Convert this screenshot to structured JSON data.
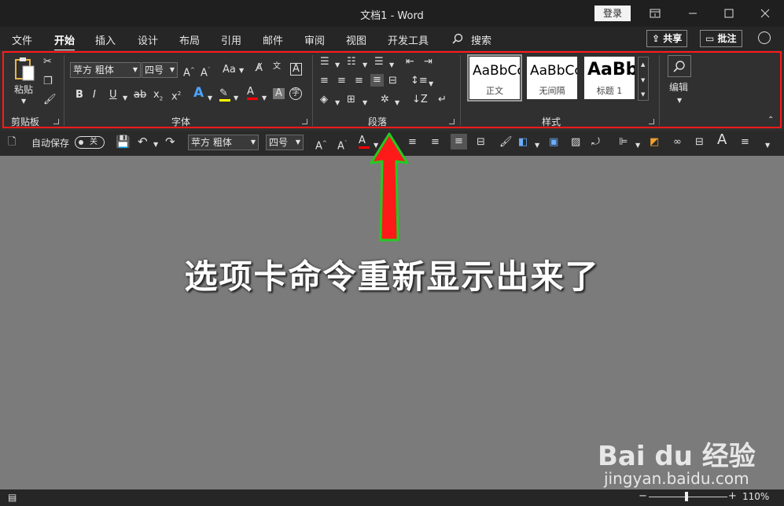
{
  "window": {
    "title": "文档1 - Word",
    "login_label": "登录"
  },
  "tabs": [
    "文件",
    "开始",
    "插入",
    "设计",
    "布局",
    "引用",
    "邮件",
    "审阅",
    "视图",
    "开发工具"
  ],
  "search_label": "搜索",
  "share_label": "共享",
  "comment_label": "批注",
  "ribbon": {
    "clipboard": {
      "paste_label": "粘贴",
      "group_label": "剪贴板"
    },
    "font": {
      "font_name": "苹方 粗体",
      "font_size": "四号",
      "case_label": "Aa",
      "group_label": "字体"
    },
    "paragraph": {
      "group_label": "段落"
    },
    "styles": {
      "group_label": "样式",
      "items": [
        {
          "sample": "AaBbCc",
          "name": "正文"
        },
        {
          "sample": "AaBbCc",
          "name": "无间隔"
        },
        {
          "sample": "AaBb",
          "name": "标题 1"
        }
      ]
    },
    "editing": {
      "label": "编辑"
    }
  },
  "qat": {
    "autosave_label": "自动保存",
    "autosave_state": "关",
    "font_name": "苹方 粗体",
    "font_size": "四号"
  },
  "annotation": "选项卡命令重新显示出来了",
  "status": {
    "zoom": "110%"
  },
  "watermark": {
    "main": "Bai du 经验",
    "sub": "jingyan.baidu.com"
  },
  "colors": {
    "highlight": "#ffff00",
    "font_color": "#ff0000",
    "outline": "#ff1a1a",
    "arrow_fill": "#ff1a1a",
    "arrow_stroke": "#22cc22"
  }
}
